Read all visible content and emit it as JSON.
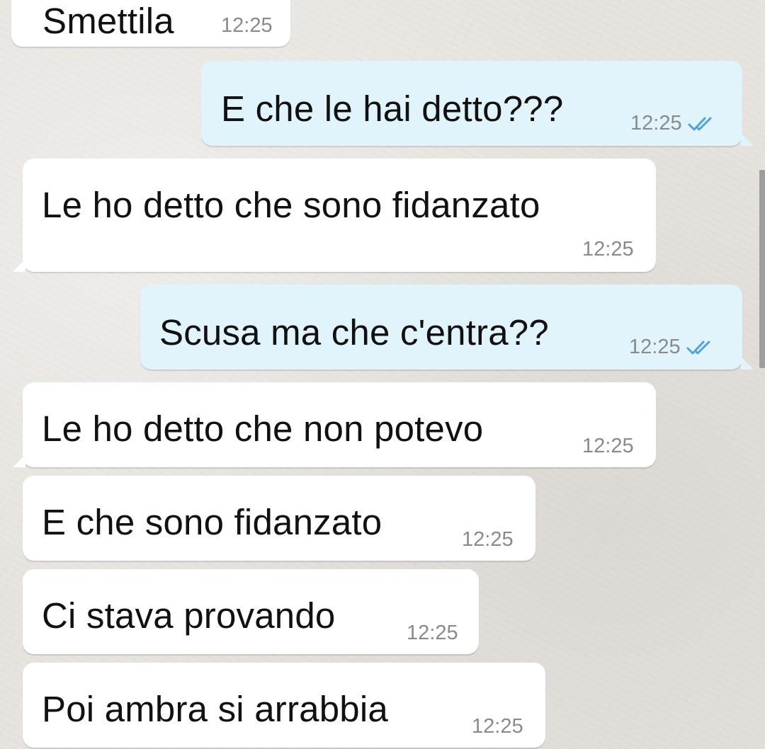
{
  "messages": [
    {
      "direction": "incoming",
      "text": "Smettila",
      "time": "12:25"
    },
    {
      "direction": "outgoing",
      "text": "E che le hai detto???",
      "time": "12:25",
      "status_icon": "double-check-read"
    },
    {
      "direction": "incoming",
      "text": "Le ho detto che sono fidanzato",
      "time": "12:25"
    },
    {
      "direction": "outgoing",
      "text": "Scusa ma che c'entra??",
      "time": "12:25",
      "status_icon": "double-check-read"
    },
    {
      "direction": "incoming",
      "text": "Le ho detto che non potevo",
      "time": "12:25"
    },
    {
      "direction": "incoming",
      "text": "E che sono fidanzato",
      "time": "12:25"
    },
    {
      "direction": "incoming",
      "text": "Ci stava provando",
      "time": "12:25"
    },
    {
      "direction": "incoming",
      "text": "Poi ambra si arrabbia",
      "time": "12:25"
    }
  ],
  "colors": {
    "incoming_bubble": "#ffffff",
    "outgoing_bubble": "#e1f4fb",
    "read_ticks": "#4fa3d9",
    "timestamp": "#8a8a8a"
  }
}
